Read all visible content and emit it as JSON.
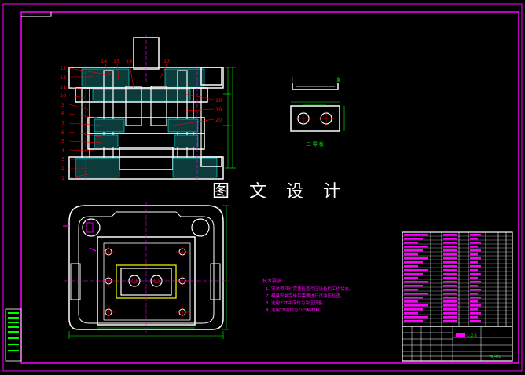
{
  "drawing": {
    "watermark": "图 文 设 计",
    "side_view_label": "二 零 板",
    "notes_title": "技术要求:",
    "notes": [
      "1. 安装模具时需要检查冲压设备的工作状态。",
      "2. 模具安装完毕后需要进行试冲压检查。",
      "3. 选用22T冲床作为冲压设备。",
      "4. 选用T8钢作为凸凹模材料。"
    ],
    "part_numbers_left": [
      "12",
      "13",
      "11",
      "10",
      "3",
      "8",
      "7",
      "6",
      "5",
      "4",
      "3",
      "2",
      "1"
    ],
    "part_numbers_top": [
      "14",
      "15",
      "16",
      "17"
    ],
    "part_numbers_right": [
      "18",
      "19",
      "20"
    ],
    "title_block_code": "WJ-00",
    "title_block_scale": "1:2.5",
    "colors": {
      "frame": "#ff00ff",
      "outline": "#ffffff",
      "dimension": "#00ff00",
      "hatch": "#00ffff",
      "leader": "#ff0000",
      "notes": "#ff00ff",
      "center": "#ffff00"
    }
  }
}
